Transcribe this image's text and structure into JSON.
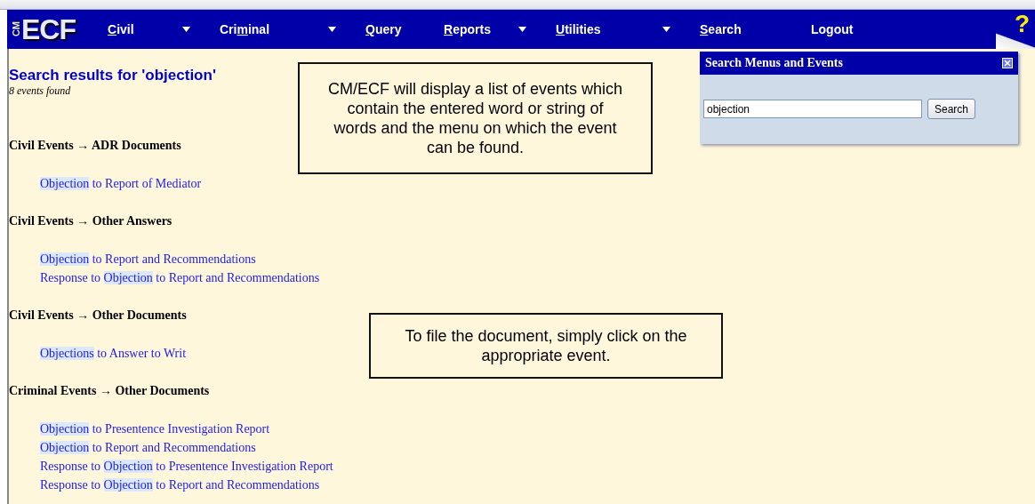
{
  "nav": {
    "logo_small": "CM",
    "logo": "ECF",
    "items": [
      {
        "key": "C",
        "after": "ivil",
        "dropdown": true
      },
      {
        "before": "Cri",
        "key": "m",
        "after": "inal",
        "dropdown": true
      },
      {
        "key": "Q",
        "after": "uery",
        "dropdown": false
      },
      {
        "key": "R",
        "after": "eports",
        "dropdown": true
      },
      {
        "key": "U",
        "after": "tilities",
        "dropdown": true
      },
      {
        "key": "S",
        "after": "earch",
        "dropdown": false
      },
      {
        "after": "Logout",
        "dropdown": false
      }
    ],
    "help": "?"
  },
  "results": {
    "title": "Search results for 'objection'",
    "count": "8 events found",
    "groups": [
      {
        "heading": "Civil Events → ADR Documents",
        "links": [
          {
            "match": "Objection",
            "after": " to Report of Mediator"
          }
        ]
      },
      {
        "heading": "Civil Events → Other Answers",
        "links": [
          {
            "match": "Objection",
            "after": " to Report and Recommendations"
          },
          {
            "before": "Response to ",
            "match": "Objection",
            "after": " to Report and Recommendations"
          }
        ]
      },
      {
        "heading": "Civil Events → Other Documents",
        "links": [
          {
            "match": "Objections",
            "after": " to Answer to Writ"
          }
        ]
      },
      {
        "heading": "Criminal Events → Other Documents",
        "links": [
          {
            "match": "Objection",
            "after": " to Presentence Investigation Report"
          },
          {
            "match": "Objection",
            "after": " to Report and Recommendations"
          },
          {
            "before": "Response to ",
            "match": "Objection",
            "after": " to Presentence Investigation Report"
          },
          {
            "before": "Response to ",
            "match": "Objection",
            "after": " to Report and Recommendations"
          }
        ]
      }
    ]
  },
  "search_panel": {
    "title": "Search Menus and Events",
    "value": "objection",
    "button": "Search"
  },
  "callouts": [
    "CM/ECF will display a list of events which contain the entered word or string of words and the menu on which the event can be found.",
    "To file the document, simply click on the appropriate event."
  ]
}
